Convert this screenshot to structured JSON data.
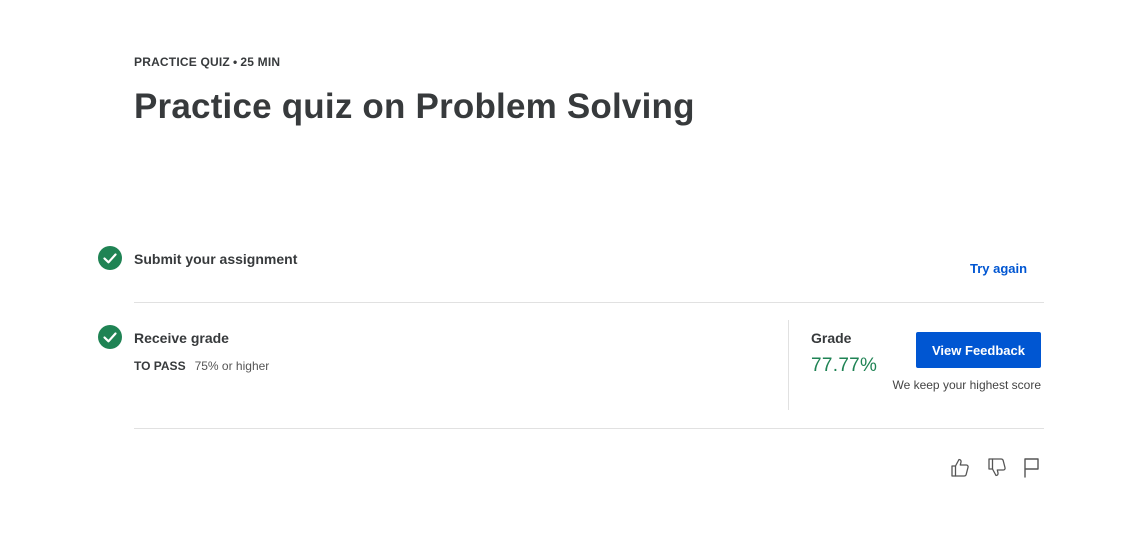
{
  "header": {
    "item_type": "PRACTICE QUIZ",
    "separator": "•",
    "duration": "25 MIN",
    "title": "Practice quiz on Problem Solving"
  },
  "steps": {
    "submit": {
      "title": "Submit your assignment",
      "action": "Try again",
      "status_icon": "check-circle-icon"
    },
    "receive": {
      "title": "Receive grade",
      "to_pass_label": "TO PASS",
      "to_pass_value": "75% or higher",
      "status_icon": "check-circle-icon"
    }
  },
  "grade": {
    "label": "Grade",
    "value": "77.77%",
    "button": "View Feedback",
    "note": "We keep your highest score"
  },
  "footer": {
    "icons": [
      "thumbs-up-icon",
      "thumbs-down-icon",
      "flag-icon"
    ]
  },
  "colors": {
    "success": "#1f8354",
    "primary": "#0056d2",
    "text": "#373a3c"
  }
}
